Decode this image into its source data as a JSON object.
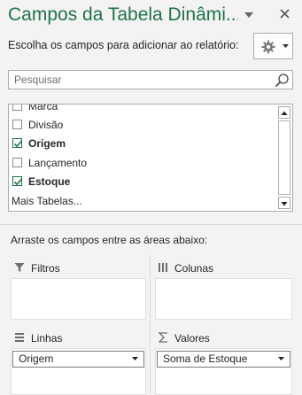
{
  "panel": {
    "title": "Campos da Tabela Dinâmi...",
    "subtitle": "Escolha os campos para adicionar ao relatório:",
    "menu_icon": "chevron-down-icon",
    "close_icon": "close-icon",
    "gear_icon": "gear-icon"
  },
  "search": {
    "placeholder": "Pesquisar",
    "icon": "search-icon"
  },
  "fields": [
    {
      "label": "Marca",
      "checked": false,
      "bold": false
    },
    {
      "label": "Divisão",
      "checked": false,
      "bold": false
    },
    {
      "label": "Origem",
      "checked": true,
      "bold": true
    },
    {
      "label": "Lançamento",
      "checked": false,
      "bold": false
    },
    {
      "label": "Estoque",
      "checked": true,
      "bold": true
    }
  ],
  "more_tables": "Mais Tabelas...",
  "areas": {
    "instruction": "Arraste os campos entre as áreas abaixo:",
    "filters": {
      "label": "Filtros",
      "icon": "filter-icon",
      "items": []
    },
    "columns": {
      "label": "Colunas",
      "icon": "columns-icon",
      "items": []
    },
    "rows": {
      "label": "Linhas",
      "icon": "rows-icon",
      "items": [
        "Origem"
      ]
    },
    "values": {
      "label": "Valores",
      "icon": "sigma-icon",
      "items": [
        "Soma de Estoque"
      ]
    }
  },
  "colors": {
    "accent": "#217346",
    "background": "#f3f3f3"
  }
}
